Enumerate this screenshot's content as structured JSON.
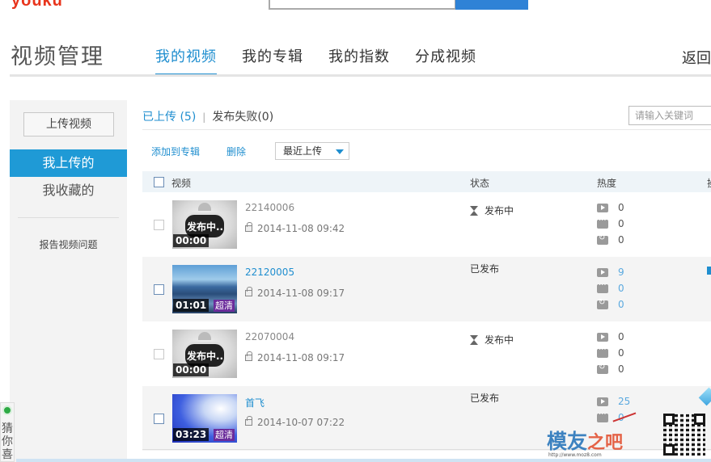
{
  "header": {
    "logo_text": "youku",
    "page_title": "视频管理",
    "tabs": [
      {
        "label": "我的视频",
        "active": true
      },
      {
        "label": "我的专辑",
        "active": false
      },
      {
        "label": "我的指数",
        "active": false
      },
      {
        "label": "分成视频",
        "active": false
      }
    ],
    "back_label": "返回"
  },
  "sidebar": {
    "upload_label": "上传视频",
    "items": [
      {
        "label": "我上传的",
        "active": true
      },
      {
        "label": "我收藏的",
        "active": false
      }
    ],
    "report_label": "报告视频问题"
  },
  "content": {
    "status_uploaded": "已上传 (5)",
    "status_separator": "|",
    "status_failed": "发布失败(0)",
    "keyword_placeholder": "请输入关键词",
    "actions": {
      "add_to_album": "添加到专辑",
      "delete": "删除",
      "sort_value": "最近上传"
    },
    "table_headers": {
      "video": "视频",
      "status": "状态",
      "heat": "热度"
    },
    "rows": [
      {
        "title": "22140006",
        "date": "2014-11-08 09:42",
        "duration": "00:00",
        "thumb_text": "发布中..",
        "hd": "",
        "status": "发布中",
        "plays": "0",
        "comments": "0",
        "shares": "0"
      },
      {
        "title": "22120005",
        "date": "2014-11-08 09:17",
        "duration": "01:01",
        "thumb_text": "",
        "hd": "超清",
        "status": "已发布",
        "plays": "9",
        "comments": "0",
        "shares": "0"
      },
      {
        "title": "22070004",
        "date": "2014-11-08 09:17",
        "duration": "00:00",
        "thumb_text": "发布中..",
        "hd": "",
        "status": "发布中",
        "plays": "0",
        "comments": "0",
        "shares": "0"
      },
      {
        "title": "首飞",
        "date": "2014-10-07 07:22",
        "duration": "03:23",
        "thumb_text": "",
        "hd": "超清",
        "status": "已发布",
        "plays": "25",
        "comments": "0",
        "shares": ""
      }
    ]
  },
  "side_widget": {
    "guess_text": "猜你喜"
  },
  "watermark": {
    "text_main": "模友",
    "text_accent": "之吧",
    "url": "http://www.moz8.com"
  },
  "colors": {
    "accent": "#1f8ecf",
    "sidebar_active": "#1f9ad6",
    "hd_badge": "#6b2c9b"
  }
}
